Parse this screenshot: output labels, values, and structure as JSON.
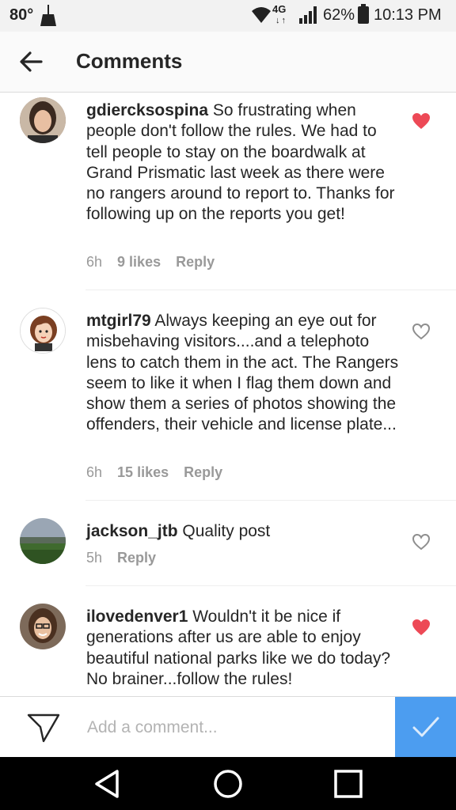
{
  "status_bar": {
    "temperature": "80°",
    "network": "4G",
    "battery_percent": "62%",
    "time": "10:13 PM"
  },
  "header": {
    "title": "Comments"
  },
  "comments": [
    {
      "username": "gdiercksospina",
      "text": " So frustrating when people don't follow the rules. We had to tell people to stay on the boardwalk at Grand Prismatic last week as there were no rangers around to report to. Thanks for following up on the reports you get!",
      "time": "6h",
      "likes": "9 likes",
      "reply": "Reply",
      "liked": true
    },
    {
      "username": "mtgirl79",
      "text": " Always keeping an eye out for misbehaving visitors....and a telephoto lens to catch them in the act. The Rangers seem to like it when I flag them down and show them a series of photos showing the offenders, their vehicle and license plate...",
      "time": "6h",
      "likes": "15 likes",
      "reply": "Reply",
      "liked": false
    },
    {
      "username": "jackson_jtb",
      "text": " Quality post",
      "time": "5h",
      "likes": "",
      "reply": "Reply",
      "liked": false
    },
    {
      "username": "ilovedenver1",
      "text": " Wouldn't it be nice if generations after us are able to enjoy beautiful national parks like we do today?  No brainer...follow the rules!",
      "time": "",
      "likes": "",
      "reply": "",
      "liked": true
    }
  ],
  "input": {
    "placeholder": "Add a comment..."
  },
  "colors": {
    "liked_heart": "#ed4956",
    "post_button": "#4c9df0",
    "meta_text": "#999999"
  },
  "icons": {
    "back": "arrow-left-icon",
    "send": "paper-plane-icon",
    "post": "checkmark-icon",
    "nav": [
      "triangle-back-icon",
      "circle-home-icon",
      "square-recents-icon"
    ]
  }
}
